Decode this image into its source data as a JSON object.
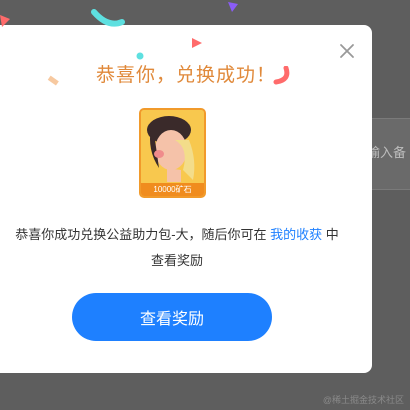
{
  "background": {
    "partial_text": "输入备"
  },
  "modal": {
    "title": "恭喜你，兑换成功！",
    "reward_card": {
      "badge_text": "10000矿石"
    },
    "message": {
      "prefix": "恭喜你成功兑换公益助力包-大，随后你可在",
      "link_text": "我的收获",
      "suffix": "中查看奖励"
    },
    "view_button_label": "查看奖励",
    "close_icon": "close-icon"
  },
  "watermark": "@稀土掘金技术社区",
  "colors": {
    "title": "#e0893a",
    "primary": "#1e80ff",
    "card_border": "#f19a2b"
  }
}
